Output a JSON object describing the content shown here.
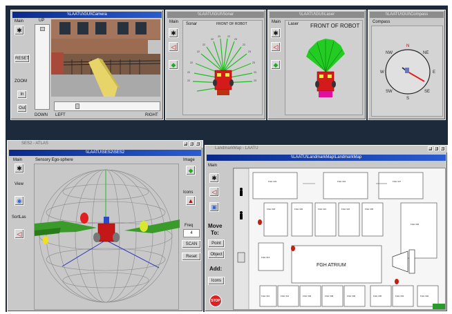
{
  "camera": {
    "title": "\\\\LAATU\\GUI\\Camera",
    "main": "Main",
    "up": "UP",
    "reset": "RESET",
    "zoom": "ZOOM",
    "zoom_in": "In",
    "zoom_out": "Out",
    "down": "DOWN",
    "left": "LEFT",
    "right": "RIGHT"
  },
  "sonar": {
    "title": "\\\\LAATU\\GUI\\Sonar",
    "main": "Main",
    "label": "Sonar",
    "front": "FRONT OF ROBOT",
    "readings": [
      "23",
      "22",
      "22",
      "23",
      "22",
      "22",
      "22",
      "23",
      "22",
      "23",
      "22",
      "23",
      "22",
      "23",
      "22",
      "23"
    ]
  },
  "laser": {
    "title": "\\\\LAATU\\GUI\\Laser",
    "main": "Main",
    "label": "Laser",
    "front": "FRONT OF ROBOT"
  },
  "compass": {
    "title": "\\\\LAATU\\GUI\\Compass",
    "label": "Compass",
    "n": "N",
    "ne": "NE",
    "e": "E",
    "se": "SE",
    "s": "S",
    "sw": "SW",
    "w": "W",
    "nw": "NW"
  },
  "ses": {
    "bar_title": "SES2 - ATLAS",
    "title": "\\\\LAATU\\SES2\\SES2",
    "main": "Main",
    "sensory": "Sensory Ego-sphere",
    "view": "View",
    "sort": "SortLas",
    "image": "Image",
    "icons": "Icons",
    "freq": "Freq",
    "freq_value": "4",
    "scan": "SCAN",
    "reset": "Reset"
  },
  "landmark": {
    "bar_title": "LandmarkMap - LAATU",
    "title": "\\\\LAATU\\LandmarkMap\\LandmarkMap",
    "main": "Main",
    "move": "Move",
    "to": "To:",
    "point": "Point",
    "object": "Object",
    "add": "Add:",
    "icons": "Icons",
    "stop": "STOP",
    "atrium": "FGH ATRIUM",
    "rooms": [
      "FGH 333",
      "FGH 331",
      "FGH 327",
      "FGH 321",
      "FGH 301",
      "FGH 318",
      "FGH 320",
      "FGH 321",
      "FGH 322",
      "FGH 336",
      "FGH 337",
      "FGH 302",
      "FGH 313",
      "FGH 310",
      "FGH 312",
      "FGH 309",
      "FGH 308",
      "FGH 306",
      "FGH 305",
      "FGH 303",
      "FGH 302"
    ]
  },
  "colors": {
    "title_bar": "#0a2a8a",
    "desktop": "#1c2a3c",
    "window": "#c9c9c9",
    "laser": "#22cc22",
    "robot": "#e01818"
  },
  "icons": [
    "robot-icon",
    "sonar-icon",
    "laser-icon",
    "ses-icon",
    "stop-icon"
  ]
}
